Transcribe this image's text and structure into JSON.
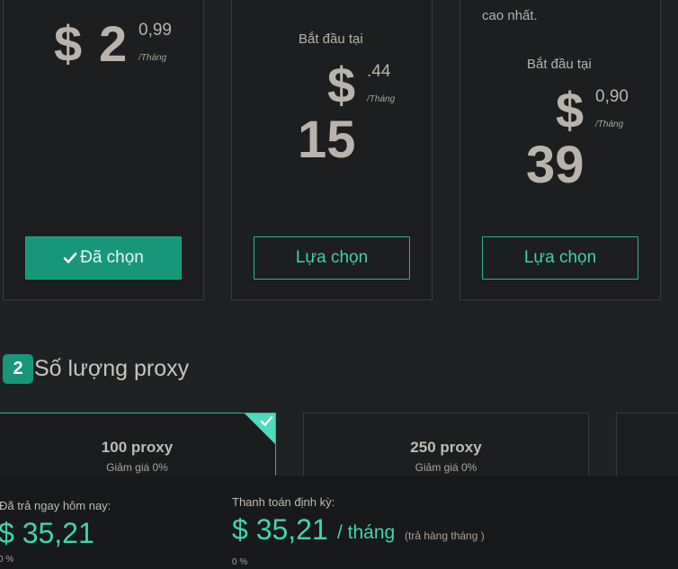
{
  "plans": [
    {
      "starts_label": "",
      "tagline": "",
      "dollar": "$",
      "whole": "2",
      "cents": "0,99",
      "per": "/Tháng",
      "button": "Đã chọn",
      "selected": true
    },
    {
      "starts_label": "Bắt đầu tại",
      "tagline": "",
      "dollar": "$",
      "whole": "15",
      "cents": ".44",
      "per": "/Tháng",
      "button": "Lựa chọn",
      "selected": false
    },
    {
      "starts_label": "Bắt đầu tại",
      "tagline": "cao nhất.",
      "dollar": "$",
      "whole": "39",
      "cents": "0,90",
      "per": "/Tháng",
      "button": "Lựa chọn",
      "selected": false
    }
  ],
  "section2": {
    "step": "2",
    "title": "Số lượng proxy"
  },
  "proxy_options": [
    {
      "name": "100 proxy",
      "discount": "Giảm giá 0%",
      "selected": true
    },
    {
      "name": "250 proxy",
      "discount": "Giảm giá 0%",
      "selected": false
    }
  ],
  "summary": {
    "today_label": "Đã trả ngay hôm nay:",
    "today_amount": "$ 35,21",
    "today_pct": "0 %",
    "recurring_label": "Thanh toán định kỳ:",
    "recurring_amount": "$ 35,21",
    "recurring_per": "/ tháng",
    "recurring_note": "(trả hàng tháng )",
    "recurring_pct": "0 %"
  },
  "colors": {
    "accent": "#17967a",
    "accent_text": "#3fd6b0",
    "background": "#1f2223"
  },
  "icons": {
    "selected_check": "check-icon",
    "corner_check": "corner-check-icon"
  }
}
